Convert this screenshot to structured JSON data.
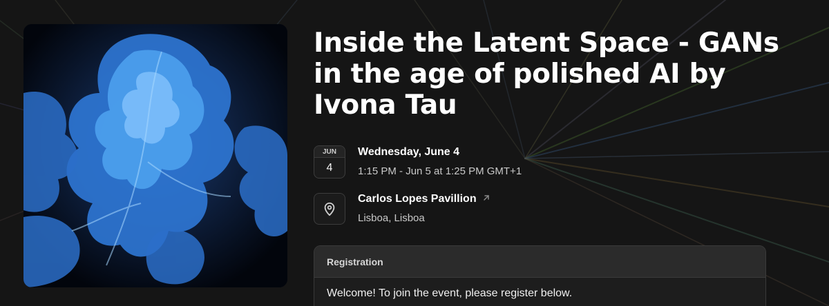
{
  "event": {
    "title": "Inside the Latent Space - GANs in the age of polished AI by Ivona Tau",
    "cover_image": "blue-abstract-gan-artwork"
  },
  "date": {
    "month": "JUN",
    "day": "4",
    "weekday_label": "Wednesday, June 4",
    "time_range": "1:15 PM - Jun 5 at 1:25 PM GMT+1"
  },
  "location": {
    "venue": "Carlos Lopes Pavillion",
    "city": "Lisboa, Lisboa",
    "icon": "map-pin-icon",
    "link_icon": "external-arrow-icon"
  },
  "registration": {
    "header": "Registration",
    "message": "Welcome! To join the event, please register below."
  },
  "colors": {
    "background": "#151515",
    "card": "#1d1d1d",
    "accent_blue": "#3a8fe0"
  }
}
